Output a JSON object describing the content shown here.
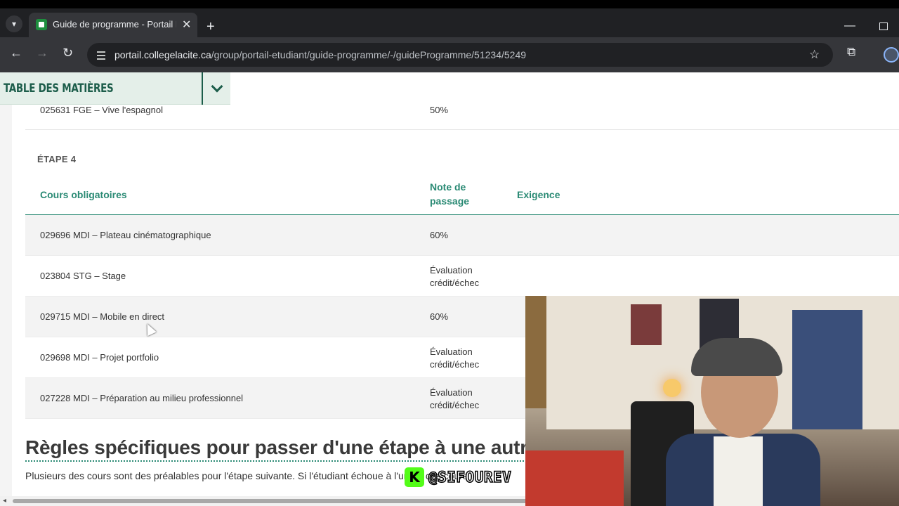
{
  "browser": {
    "tab_title": "Guide de programme - Portail Étudiant",
    "url_host": "portail.collegelacite.ca",
    "url_path": "/group/portail-etudiant/guide-programme/-/guideProgramme/51234/5249"
  },
  "toc": {
    "title": "TABLE DES MATIÈRES"
  },
  "prev_row": {
    "course": "025631 FGE – Vive l'espagnol",
    "grade": "50%"
  },
  "etape": "ÉTAPE 4",
  "table": {
    "headers": {
      "course": "Cours obligatoires",
      "grade_line1": "Note de",
      "grade_line2": "passage",
      "requirement": "Exigence"
    },
    "rows": [
      {
        "course": "029696 MDI – Plateau cinématographique",
        "grade1": "60%",
        "grade2": ""
      },
      {
        "course": "023804 STG – Stage",
        "grade1": "Évaluation",
        "grade2": "crédit/échec"
      },
      {
        "course": "029715 MDI – Mobile en direct",
        "grade1": "60%",
        "grade2": ""
      },
      {
        "course": "029698 MDI – Projet portfolio",
        "grade1": "Évaluation",
        "grade2": "crédit/échec"
      },
      {
        "course": "027228 MDI – Préparation au milieu professionnel",
        "grade1": "Évaluation",
        "grade2": "crédit/échec"
      }
    ]
  },
  "rules": {
    "title": "Règles spécifiques pour passer d'une étape à une autre",
    "text": "Plusieurs des cours sont des préalables pour l'étape suivante. Si l'étudiant échoue à l'un de ces cours"
  },
  "overlay": {
    "handle": "@SIFOUREV",
    "logo_letter": "K"
  }
}
